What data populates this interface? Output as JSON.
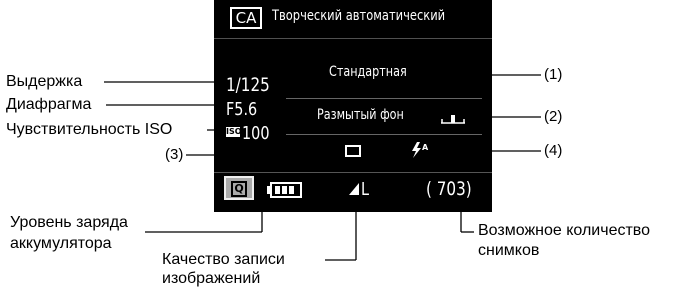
{
  "screen": {
    "mode_icon": "CA",
    "mode_title": "Творческий автоматический",
    "shutter": "1/125",
    "aperture": "F5.6",
    "iso_value": "100",
    "picture_style": "Стандартная",
    "background_blur": "Размытый фон",
    "quality": "L",
    "shots": "( 703)",
    "quick_button": "Q"
  },
  "callouts": {
    "shutter": "Выдержка",
    "aperture": "Диафрагма",
    "iso": "Чувствительность ISO",
    "battery_1": "Уровень заряда",
    "battery_2": "аккумулятора",
    "quality_1": "Качество записи",
    "quality_2": "изображений",
    "shots_1": "Возможное количество",
    "shots_2": "снимков",
    "n1": "(1)",
    "n2": "(2)",
    "n3": "(3)",
    "n4": "(4)"
  },
  "icons": [
    "mode-ca-icon",
    "battery-icon",
    "single-shot-drive-icon",
    "flash-auto-icon",
    "blur-scale-icon",
    "quality-large-icon",
    "quick-control-icon"
  ]
}
